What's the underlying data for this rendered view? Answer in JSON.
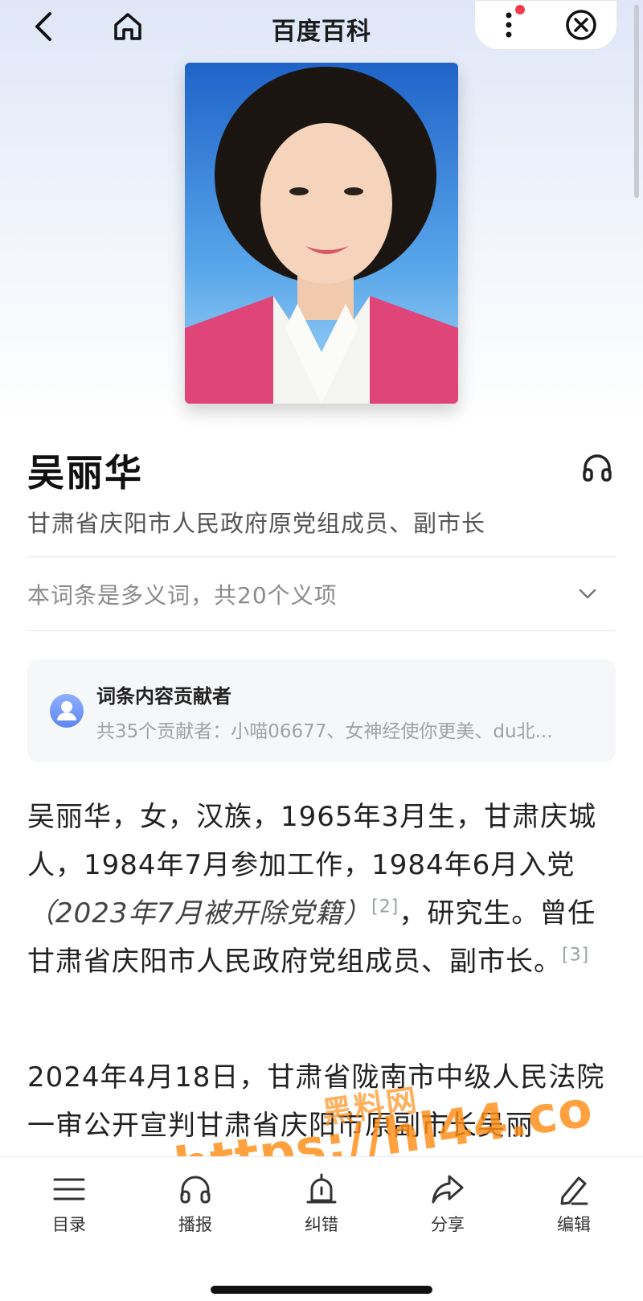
{
  "header": {
    "title": "百度百科",
    "icons": {
      "back": "chevron-left-icon",
      "home": "home-icon",
      "more": "more-vertical-icon",
      "close": "close-circle-icon"
    },
    "notification_dot_color": "#f33b4f"
  },
  "entry": {
    "name": "吴丽华",
    "description": "甘肃省庆阳市人民政府原党组成员、副市长",
    "polysemy_note": "本词条是多义词，共20个义项"
  },
  "contributors": {
    "title": "词条内容贡献者",
    "summary": "共35个贡献者：小喵06677、女神经使你更美、du北..."
  },
  "content": {
    "para1_a": "吴丽华，女，汉族，1965年3月生，甘肃庆城人，1984年7月参加工作，1984年6月入党",
    "para1_italic": "（2023年7月被开除党籍）",
    "para1_ref1": "[2]",
    "para1_b": "，研究生。曾任甘肃省庆阳市人民政府党组成员、副市长。",
    "para1_ref2": "[3]",
    "para2": "2024年4月18日，甘肃省陇南市中级人民法院一审公开宣判甘肃省庆阳市原副市长吴丽"
  },
  "watermark": {
    "line1": "黑料网",
    "line2": "https://hl44.co"
  },
  "bottom_nav": [
    {
      "label": "目录",
      "icon": "list-icon"
    },
    {
      "label": "播报",
      "icon": "headphones-icon"
    },
    {
      "label": "纠错",
      "icon": "alert-bell-icon"
    },
    {
      "label": "分享",
      "icon": "share-icon"
    },
    {
      "label": "编辑",
      "icon": "pencil-icon"
    }
  ]
}
